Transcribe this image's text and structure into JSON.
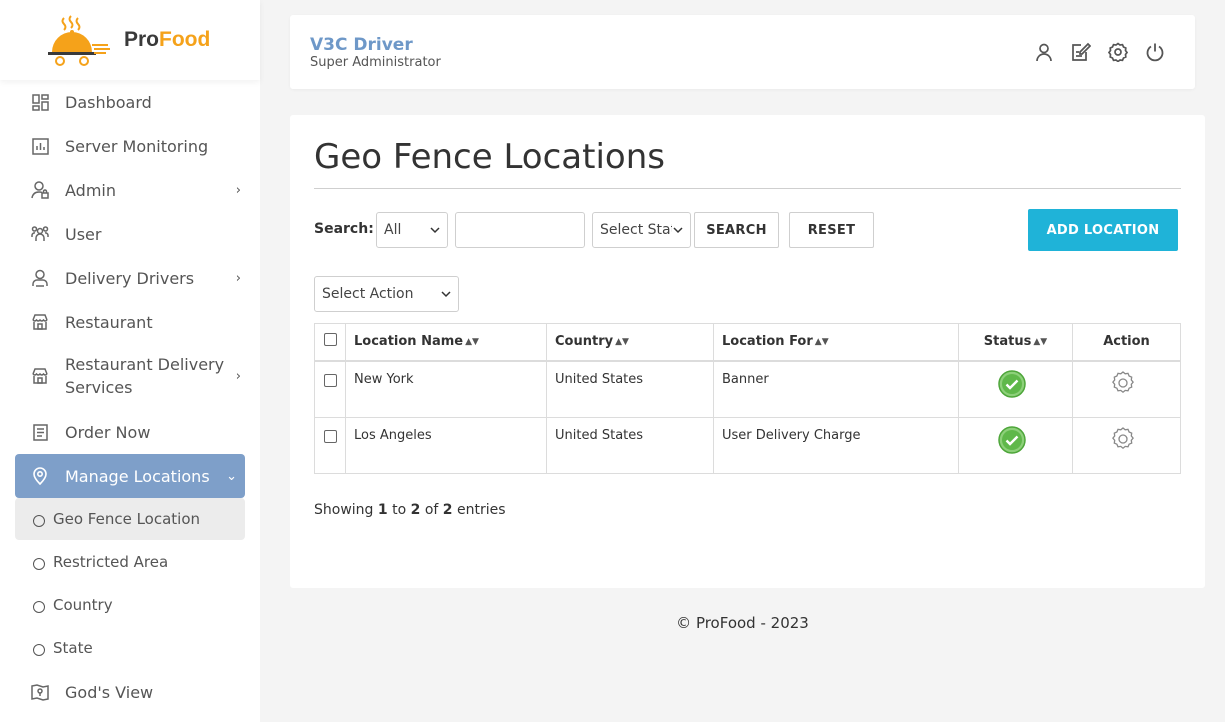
{
  "brand": {
    "name_part1": "Pro",
    "name_part2": "Food",
    "accent_color": "#f5a21a"
  },
  "header": {
    "title": "V3C Driver",
    "subtitle": "Super Administrator",
    "icons": [
      "user-icon",
      "edit-icon",
      "settings-icon",
      "power-icon"
    ]
  },
  "sidebar": {
    "items": [
      {
        "label": "Dashboard",
        "icon": "dashboard-icon"
      },
      {
        "label": "Server Monitoring",
        "icon": "chart-icon"
      },
      {
        "label": "Admin",
        "icon": "admin-icon",
        "has_submenu": true
      },
      {
        "label": "User",
        "icon": "users-icon"
      },
      {
        "label": "Delivery Drivers",
        "icon": "driver-icon",
        "has_submenu": true
      },
      {
        "label": "Restaurant",
        "icon": "store-icon"
      },
      {
        "label": "Restaurant Delivery Services",
        "icon": "store-icon",
        "has_submenu": true
      },
      {
        "label": "Order Now",
        "icon": "order-icon"
      },
      {
        "label": "Manage Locations",
        "icon": "location-pin-icon",
        "expanded": true
      },
      {
        "label": "God's View",
        "icon": "map-icon"
      }
    ],
    "subitems": [
      {
        "label": "Geo Fence Location",
        "current": true
      },
      {
        "label": "Restricted Area"
      },
      {
        "label": "Country"
      },
      {
        "label": "State"
      }
    ],
    "active_color": "#7e9fc9"
  },
  "main": {
    "page_title": "Geo Fence Locations",
    "search_label": "Search:",
    "filter_select": "All",
    "search_input_value": "",
    "status_select": "Select Status",
    "search_button": "SEARCH",
    "reset_button": "RESET",
    "add_button": "ADD LOCATION",
    "add_button_color": "#1fb3d8",
    "action_select": "Select Action",
    "table": {
      "columns": [
        "Location Name",
        "Country",
        "Location For",
        "Status",
        "Action"
      ],
      "rows": [
        {
          "name": "New York",
          "country": "United States",
          "location_for": "Banner",
          "status": "active"
        },
        {
          "name": "Los Angeles",
          "country": "United States",
          "location_for": "User Delivery Charge",
          "status": "active"
        }
      ]
    },
    "showing": {
      "prefix": "Showing",
      "from": "1",
      "to_word": "to",
      "to": "2",
      "of_word": "of",
      "total": "2",
      "suffix": "entries"
    }
  },
  "footer": {
    "text": "© ProFood - 2023"
  }
}
